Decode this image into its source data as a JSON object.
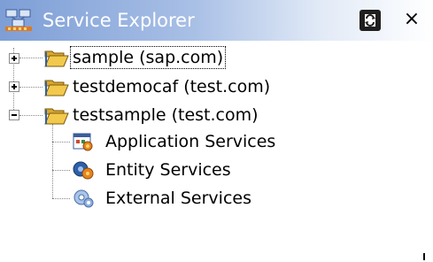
{
  "window": {
    "title": "Service Explorer",
    "title_icon": "service-explorer-icon",
    "refresh_icon": "refresh-icon",
    "close_label": "×"
  },
  "tree": {
    "nodes": [
      {
        "label": "sample (sap.com)",
        "expanded": false,
        "icon": "open-folder-icon",
        "focused": true
      },
      {
        "label": "testdemocaf (test.com)",
        "expanded": false,
        "icon": "open-folder-icon"
      },
      {
        "label": "testsample (test.com)",
        "expanded": true,
        "icon": "open-folder-icon",
        "children": [
          {
            "label": "Application Services",
            "icon": "application-services-icon"
          },
          {
            "label": "Entity Services",
            "icon": "entity-services-icon"
          },
          {
            "label": "External Services",
            "icon": "external-services-icon"
          }
        ]
      }
    ]
  },
  "colors": {
    "titlebar_start": "#7d9ed6",
    "titlebar_end": "#ffffff",
    "folder": "#f2c94c"
  }
}
